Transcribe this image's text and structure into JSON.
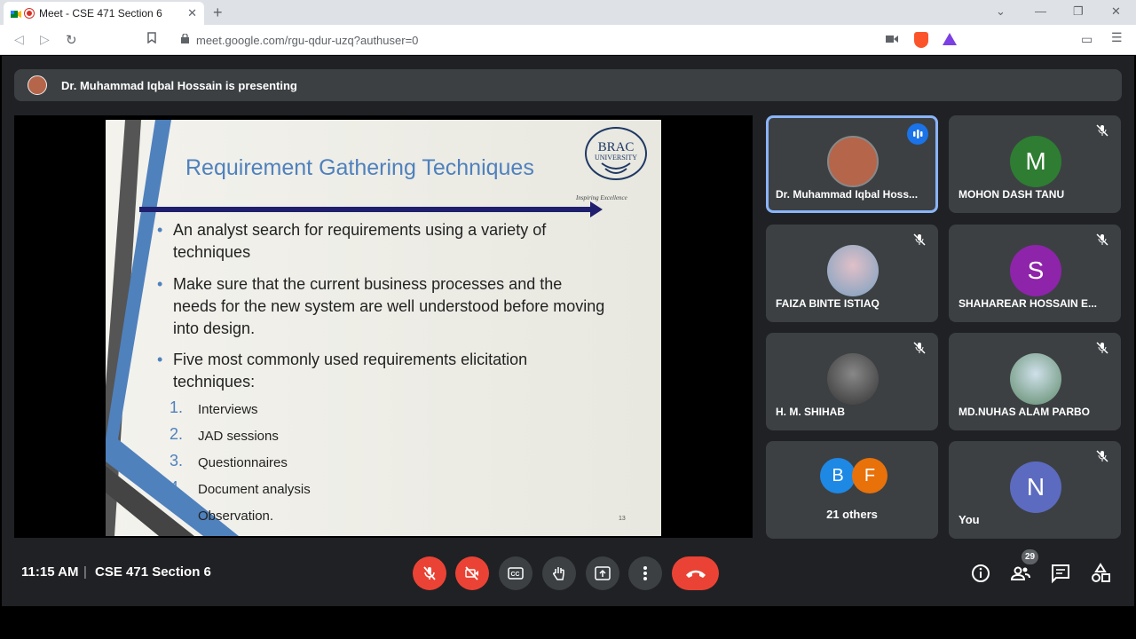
{
  "browser": {
    "tab_title": "Meet - CSE 471 Section 6",
    "url": "meet.google.com/rgu-qdur-uzq?authuser=0"
  },
  "banner": {
    "text": "Dr. Muhammad Iqbal Hossain is presenting"
  },
  "slide": {
    "title": "Requirement Gathering Techniques",
    "logo_line1": "BRAC",
    "logo_line2": "UNIVERSITY",
    "tagline": "Inspiring Excellence",
    "bullets": [
      "An analyst search for requirements using a variety of techniques",
      "Make sure that the current business processes and the needs for the new system are well understood before moving into design.",
      "Five most commonly used requirements elicitation techniques:"
    ],
    "numbered": [
      {
        "n": "1.",
        "text": "Interviews"
      },
      {
        "n": "2.",
        "text": "JAD sessions"
      },
      {
        "n": "3.",
        "text": "Questionnaires"
      },
      {
        "n": "4.",
        "text": "Document analysis"
      },
      {
        "n": "",
        "text": "Observation."
      }
    ],
    "page": "13"
  },
  "tiles": [
    {
      "name": "Dr. Muhammad Iqbal Hoss...",
      "initial": "",
      "color": "#b5654a"
    },
    {
      "name": "MOHON DASH TANU",
      "initial": "M",
      "color": "#2e7d32"
    },
    {
      "name": "FAIZA BINTE ISTIAQ",
      "initial": "",
      "color": "#9fb3c8"
    },
    {
      "name": "SHAHAREAR HOSSAIN E...",
      "initial": "S",
      "color": "#8e24aa"
    },
    {
      "name": "H. M. SHIHAB",
      "initial": "",
      "color": "#5a5a5a"
    },
    {
      "name": "MD.NUHAS ALAM PARBO",
      "initial": "",
      "color": "#7fa3b8"
    },
    {
      "name": "21 others",
      "initial_b": "B",
      "initial_f": "F",
      "color_b": "#1e88e5",
      "color_f": "#e8710a"
    },
    {
      "name": "You",
      "initial": "N",
      "color": "#5c6bc0"
    }
  ],
  "bottom": {
    "time": "11:15 AM",
    "separator": "|",
    "meeting": "CSE 471 Section 6",
    "participants_count": "29"
  },
  "colors": {
    "accent": "#8ab4f8",
    "danger": "#ea4335",
    "surface": "#3c4043"
  }
}
